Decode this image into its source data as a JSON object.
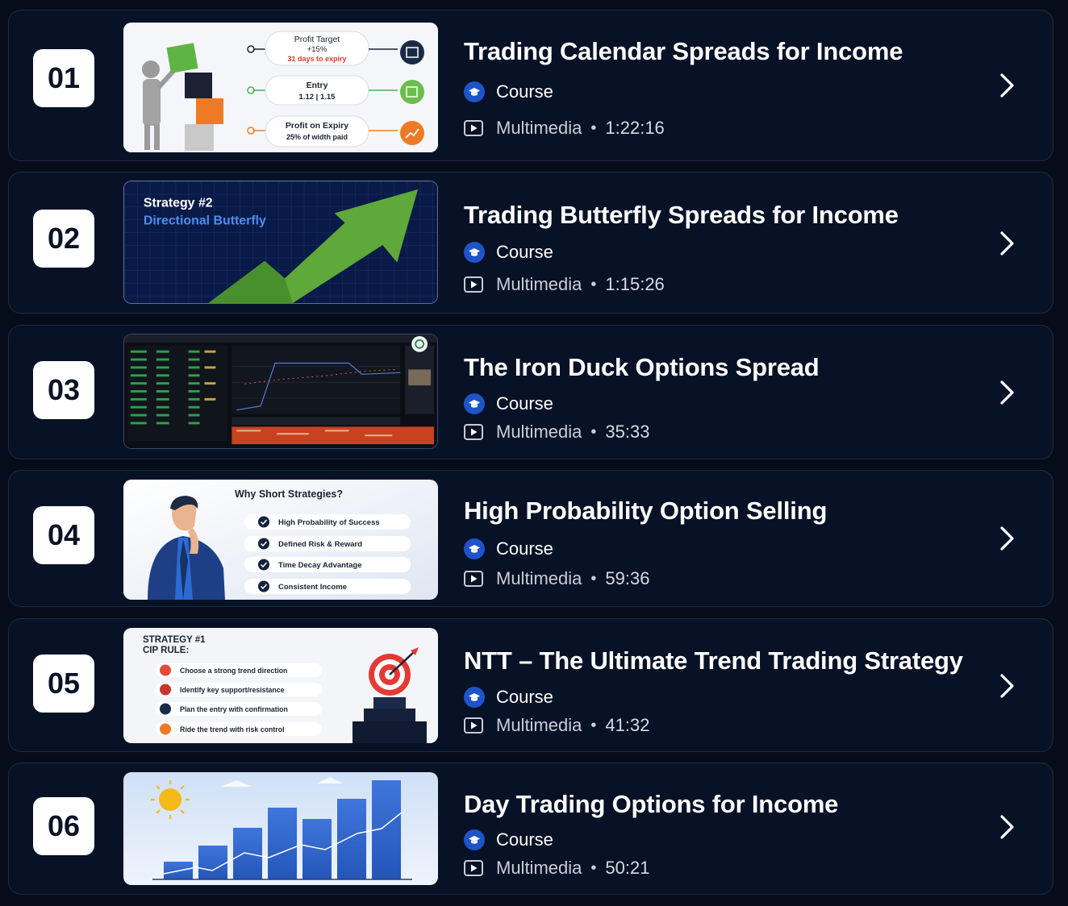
{
  "courses": [
    {
      "number": "01",
      "title": "Trading Calendar Spreads for Income",
      "type_label": "Course",
      "media_label": "Multimedia",
      "duration": "1:22:16",
      "thumbnail": {
        "icon": "calendar-spread-infographic",
        "steps": [
          {
            "line1": "Profit Target",
            "line2": "+15%",
            "line3": "31 days to expiry"
          },
          {
            "line1": "Entry",
            "line2": "1.12 | 1.15"
          },
          {
            "line1": "Profit on Expiry",
            "line2": "25% of width paid"
          }
        ]
      }
    },
    {
      "number": "02",
      "title": "Trading Butterfly Spreads for Income",
      "type_label": "Course",
      "media_label": "Multimedia",
      "duration": "1:15:26",
      "thumbnail": {
        "icon": "rising-arrow-chart",
        "line1": "Strategy #2",
        "line2": "Directional Butterfly"
      }
    },
    {
      "number": "03",
      "title": "The Iron Duck Options Spread",
      "type_label": "Course",
      "media_label": "Multimedia",
      "duration": "35:33",
      "thumbnail": {
        "icon": "trading-platform-screenshot"
      }
    },
    {
      "number": "04",
      "title": "High Probability Option Selling",
      "type_label": "Course",
      "media_label": "Multimedia",
      "duration": "59:36",
      "thumbnail": {
        "icon": "thinking-man-checklist",
        "heading": "Why Short Strategies?",
        "items": [
          "High Probability of Success",
          "Defined Risk & Reward",
          "Time Decay Advantage",
          "Consistent Income"
        ]
      }
    },
    {
      "number": "05",
      "title": "NTT – The Ultimate Trend Trading Strategy",
      "type_label": "Course",
      "media_label": "Multimedia",
      "duration": "41:32",
      "thumbnail": {
        "icon": "target-checklist",
        "line1": "STRATEGY #1",
        "line2": "CIP RULE:",
        "items": [
          "Choose a strong trend direction",
          "Identify key support/resistance",
          "Plan the entry with confirmation",
          "Ride the trend with risk control"
        ]
      }
    },
    {
      "number": "06",
      "title": "Day Trading Options for Income",
      "type_label": "Course",
      "media_label": "Multimedia",
      "duration": "50:21",
      "thumbnail": {
        "icon": "sun-bar-chart"
      }
    }
  ],
  "colors": {
    "background": "#050c1a",
    "card": "#081226",
    "card_border": "#1f2b40",
    "course_icon": "#1f53c9",
    "accent_green": "#4caf50",
    "accent_orange": "#f07c2a",
    "accent_blue": "#3b6fd8"
  }
}
